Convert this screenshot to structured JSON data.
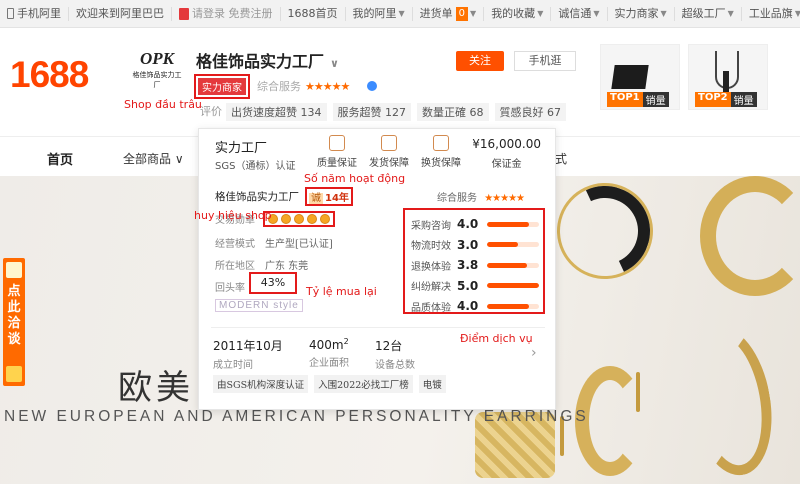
{
  "topbar": {
    "mobile_site": "手机阿里",
    "welcome": "欢迎来到阿里巴巴",
    "login": "请登录",
    "register": "免费注册",
    "home": "1688首页",
    "my_ali": "我的阿里",
    "purchase_list": "进货单",
    "purchase_count": "0",
    "favorites": "我的收藏",
    "trust": "诚信通",
    "strength_merchant": "实力商家",
    "super_factory": "超级工厂",
    "industry_flagship": "工业品旗"
  },
  "header": {
    "site_logo": "1688",
    "shop_logo_mark": "OPK",
    "shop_logo_sub": "格佳饰品实力工厂",
    "shop_name": "格佳饰品实力工厂",
    "strength_badge": "实力商家",
    "composite_label": "综合服务",
    "composite_stars": "★★★★★",
    "follow_button": "关注",
    "mobile_shop_button": "手机逛",
    "eval_label": "评价",
    "eval_chips": [
      "出货速度超赞 134",
      "服务超赞 127",
      "数量正確 68",
      "質感良好 67"
    ]
  },
  "top_products": [
    {
      "rank": "TOP1",
      "label": "销量"
    },
    {
      "rank": "TOP2",
      "label": "销量"
    }
  ],
  "nav": {
    "home": "首页",
    "all_products": "全部商品",
    "cut_text": "式"
  },
  "banner": {
    "headline": "欧美",
    "subtitle": "NEW EUROPEAN AND AMERICAN PERSONALITY EARRINGS",
    "consult_text": "点此洽谈"
  },
  "card": {
    "title": "实力工厂",
    "sgs": "SGS（通标）认证",
    "guarantees": [
      "质量保证",
      "发货保障",
      "换货保障"
    ],
    "deposit_value": "¥16,000.00",
    "deposit_label": "保证金",
    "company_name": "格佳饰品实力工厂",
    "years_icon": "诚",
    "years": "14年",
    "composite_label": "综合服务",
    "composite_stars": "★★★★★",
    "trade_medal_label": "交易勋章",
    "business_mode_label": "经营模式",
    "business_mode_value": "生产型[已认证]",
    "region_label": "所在地区",
    "region_value": "广东 东莞",
    "repeat_rate_label": "回头率",
    "repeat_rate_value": "43%",
    "modern_style": "MODERN style",
    "scores": [
      {
        "label": "采购咨询",
        "value": "4.0",
        "fraction": 0.8
      },
      {
        "label": "物流时效",
        "value": "3.0",
        "fraction": 0.6
      },
      {
        "label": "退换体验",
        "value": "3.8",
        "fraction": 0.76
      },
      {
        "label": "纠纷解决",
        "value": "5.0",
        "fraction": 1.0
      },
      {
        "label": "品质体验",
        "value": "4.0",
        "fraction": 0.8
      }
    ],
    "stats": [
      {
        "value": "2011年10月",
        "label": "成立时间"
      },
      {
        "value": "400m",
        "sup": "2",
        "label": "企业面积"
      },
      {
        "value": "12台",
        "label": "设备总数"
      }
    ],
    "tags": [
      "由SGS机构深度认证",
      "入围2022必找工厂榜",
      "电镀"
    ]
  },
  "annotations": {
    "shop_level": "Shop đầu trâu",
    "years_active": "Số năm hoạt động",
    "shop_badge": "huy hiệu  shop",
    "repurchase_rate": "Tỷ lệ mua lại",
    "service_score": "Điểm dịch vụ"
  },
  "colors": {
    "accent": "#ff5000",
    "annotation_red": "#e31a1a",
    "brand_orange": "#ff4400"
  }
}
